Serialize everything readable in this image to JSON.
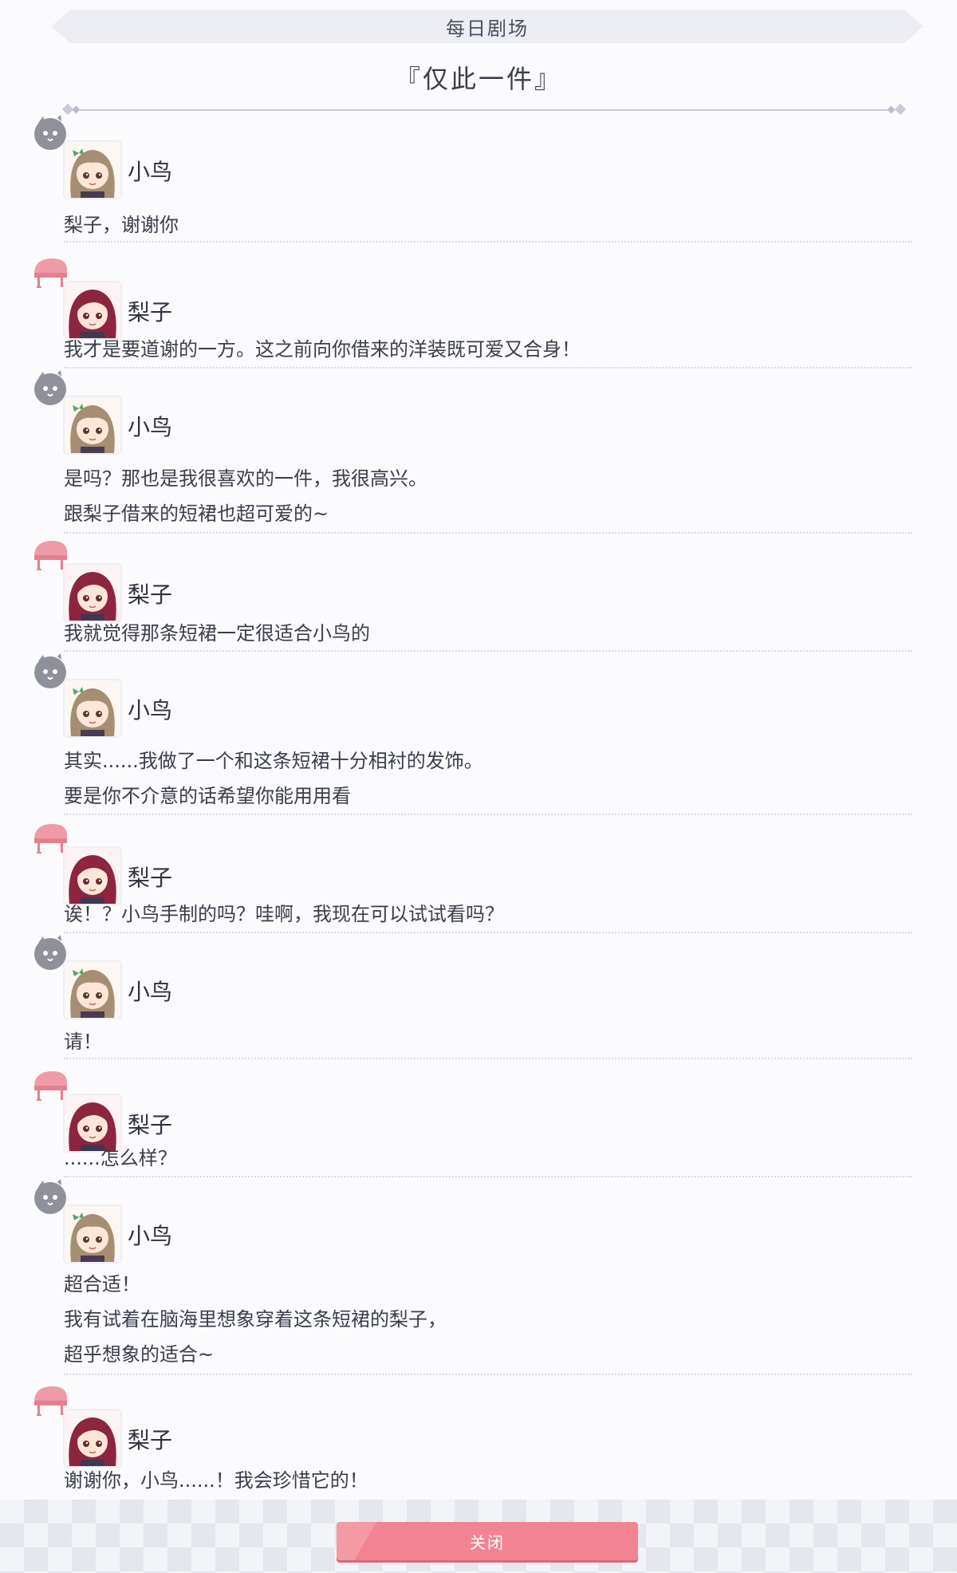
{
  "header": {
    "section_label": "每日剧场",
    "story_title": "『仅此一件』"
  },
  "icons": {
    "kotori_emblem": "bird-emblem-icon",
    "riko_emblem": "piano-emblem-icon"
  },
  "colors": {
    "close_button": "#f28491",
    "separator": "#d7d9e0",
    "kotori_hair": "#a68e72",
    "riko_hair": "#8d2540"
  },
  "dialogue": [
    {
      "speaker": "小鸟",
      "lines": [
        "梨子，谢谢你"
      ]
    },
    {
      "speaker": "梨子",
      "lines": [
        "我才是要道谢的一方。这之前向你借来的洋装既可爱又合身！"
      ]
    },
    {
      "speaker": "小鸟",
      "lines": [
        "是吗？那也是我很喜欢的一件，我很高兴。",
        "跟梨子借来的短裙也超可爱的~"
      ]
    },
    {
      "speaker": "梨子",
      "lines": [
        "我就觉得那条短裙一定很适合小鸟的"
      ]
    },
    {
      "speaker": "小鸟",
      "lines": [
        "其实......我做了一个和这条短裙十分相衬的发饰。",
        "要是你不介意的话希望你能用用看"
      ]
    },
    {
      "speaker": "梨子",
      "lines": [
        "诶！？小鸟手制的吗？哇啊，我现在可以试试看吗？"
      ]
    },
    {
      "speaker": "小鸟",
      "lines": [
        "请！"
      ]
    },
    {
      "speaker": "梨子",
      "lines": [
        "......怎么样？"
      ]
    },
    {
      "speaker": "小鸟",
      "lines": [
        "超合适！",
        "我有试着在脑海里想象穿着这条短裙的梨子，",
        "超乎想象的适合~"
      ]
    },
    {
      "speaker": "梨子",
      "lines": [
        "谢谢你，小鸟......！我会珍惜它的！"
      ]
    }
  ],
  "footer": {
    "close_label": "关闭"
  }
}
